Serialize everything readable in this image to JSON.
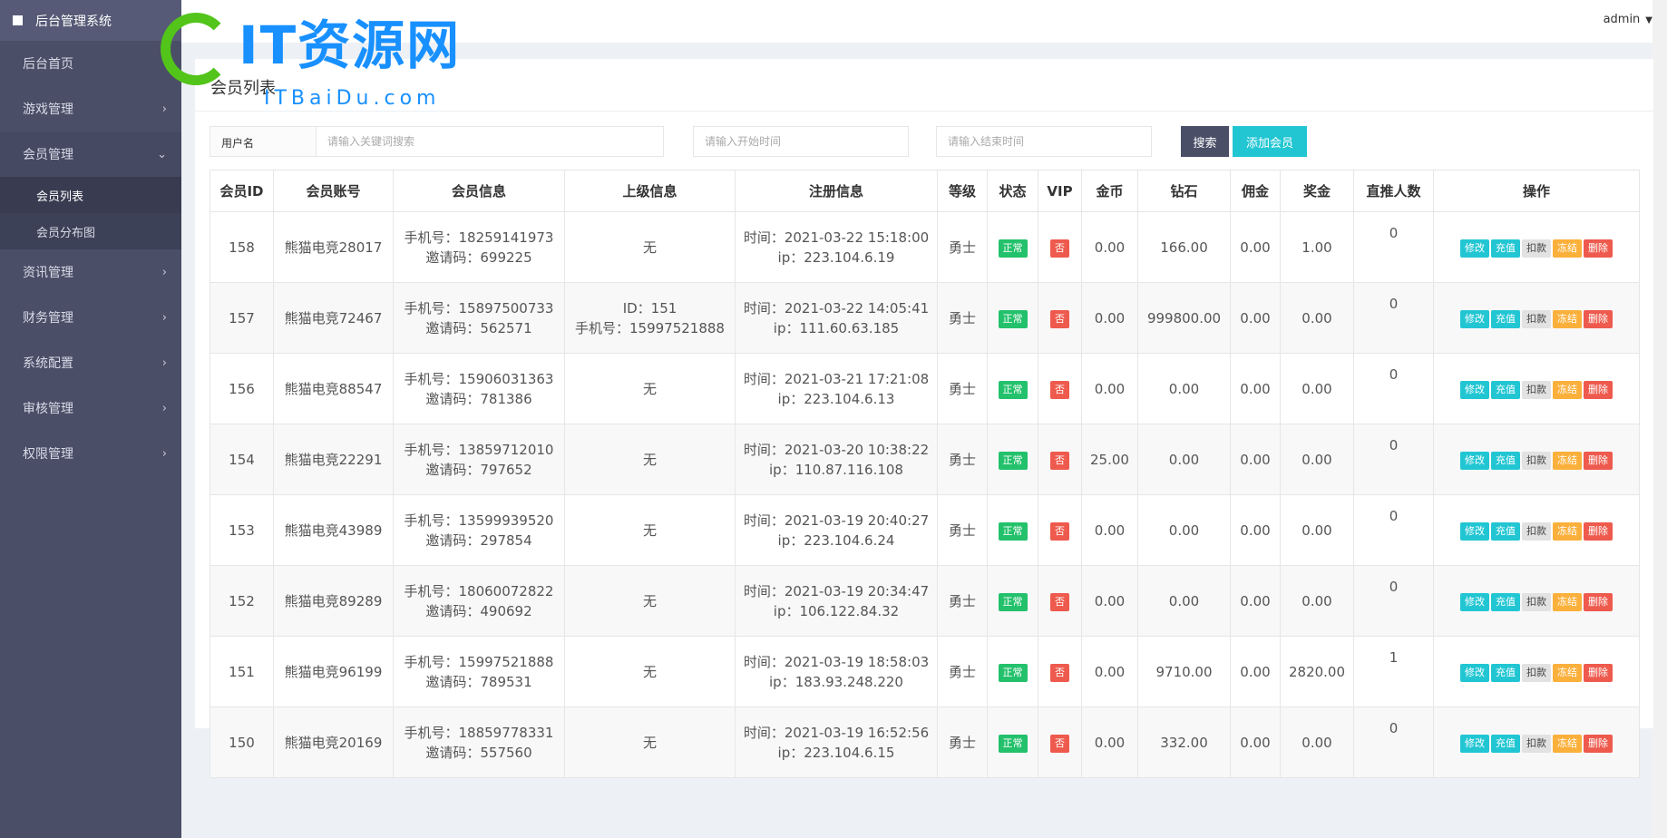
{
  "sidebar": {
    "brand": "后台管理系统",
    "items": [
      {
        "label": "后台首页",
        "has_children": false
      },
      {
        "label": "游戏管理",
        "has_children": true
      },
      {
        "label": "会员管理",
        "has_children": true,
        "open": true,
        "children": [
          {
            "label": "会员列表",
            "active": true
          },
          {
            "label": "会员分布图"
          }
        ]
      },
      {
        "label": "资讯管理",
        "has_children": true
      },
      {
        "label": "财务管理",
        "has_children": true
      },
      {
        "label": "系统配置",
        "has_children": true
      },
      {
        "label": "审核管理",
        "has_children": true
      },
      {
        "label": "权限管理",
        "has_children": true
      }
    ]
  },
  "topbar": {
    "user": "admin"
  },
  "watermark": {
    "big": "IT资源网",
    "small": "ITBaiDu.com"
  },
  "card": {
    "title": "会员列表"
  },
  "search": {
    "label": "用户名",
    "keyword_placeholder": "请输入关键词搜索",
    "start_placeholder": "请输入开始时间",
    "end_placeholder": "请输入结束时间",
    "search_button": "搜索",
    "add_button": "添加会员"
  },
  "colors": {
    "search_btn": "#4a4e67",
    "add_btn": "#22c6d3",
    "sidebar": "#4a4e67"
  },
  "table": {
    "headers": [
      "会员ID",
      "会员账号",
      "会员信息",
      "上级信息",
      "注册信息",
      "等级",
      "状态",
      "VIP",
      "金币",
      "钻石",
      "佣金",
      "奖金",
      "直推人数",
      "操作"
    ],
    "ops": [
      "修改",
      "充值",
      "扣款",
      "冻结",
      "删除"
    ],
    "rows": [
      {
        "id": "158",
        "account": "熊猫电竞28017",
        "phone": "手机号：18259141973",
        "invite": "邀请码：699225",
        "parent1": "无",
        "parent2": "",
        "time": "时间：2021-03-22 15:18:00",
        "ip": "ip：223.104.6.19",
        "level": "勇士",
        "status": "正常",
        "vip": "否",
        "gold": "0.00",
        "diamond": "166.00",
        "commission": "0.00",
        "bonus": "1.00",
        "direct": "0"
      },
      {
        "id": "157",
        "account": "熊猫电竞72467",
        "phone": "手机号：15897500733",
        "invite": "邀请码：562571",
        "parent1": "ID：151",
        "parent2": "手机号：15997521888",
        "time": "时间：2021-03-22 14:05:41",
        "ip": "ip：111.60.63.185",
        "level": "勇士",
        "status": "正常",
        "vip": "否",
        "gold": "0.00",
        "diamond": "999800.00",
        "commission": "0.00",
        "bonus": "0.00",
        "direct": "0"
      },
      {
        "id": "156",
        "account": "熊猫电竞88547",
        "phone": "手机号：15906031363",
        "invite": "邀请码：781386",
        "parent1": "无",
        "parent2": "",
        "time": "时间：2021-03-21 17:21:08",
        "ip": "ip：223.104.6.13",
        "level": "勇士",
        "status": "正常",
        "vip": "否",
        "gold": "0.00",
        "diamond": "0.00",
        "commission": "0.00",
        "bonus": "0.00",
        "direct": "0"
      },
      {
        "id": "154",
        "account": "熊猫电竞22291",
        "phone": "手机号：13859712010",
        "invite": "邀请码：797652",
        "parent1": "无",
        "parent2": "",
        "time": "时间：2021-03-20 10:38:22",
        "ip": "ip：110.87.116.108",
        "level": "勇士",
        "status": "正常",
        "vip": "否",
        "gold": "25.00",
        "diamond": "0.00",
        "commission": "0.00",
        "bonus": "0.00",
        "direct": "0"
      },
      {
        "id": "153",
        "account": "熊猫电竞43989",
        "phone": "手机号：13599939520",
        "invite": "邀请码：297854",
        "parent1": "无",
        "parent2": "",
        "time": "时间：2021-03-19 20:40:27",
        "ip": "ip：223.104.6.24",
        "level": "勇士",
        "status": "正常",
        "vip": "否",
        "gold": "0.00",
        "diamond": "0.00",
        "commission": "0.00",
        "bonus": "0.00",
        "direct": "0"
      },
      {
        "id": "152",
        "account": "熊猫电竞89289",
        "phone": "手机号：18060072822",
        "invite": "邀请码：490692",
        "parent1": "无",
        "parent2": "",
        "time": "时间：2021-03-19 20:34:47",
        "ip": "ip：106.122.84.32",
        "level": "勇士",
        "status": "正常",
        "vip": "否",
        "gold": "0.00",
        "diamond": "0.00",
        "commission": "0.00",
        "bonus": "0.00",
        "direct": "0"
      },
      {
        "id": "151",
        "account": "熊猫电竞96199",
        "phone": "手机号：15997521888",
        "invite": "邀请码：789531",
        "parent1": "无",
        "parent2": "",
        "time": "时间：2021-03-19 18:58:03",
        "ip": "ip：183.93.248.220",
        "level": "勇士",
        "status": "正常",
        "vip": "否",
        "gold": "0.00",
        "diamond": "9710.00",
        "commission": "0.00",
        "bonus": "2820.00",
        "direct": "1"
      },
      {
        "id": "150",
        "account": "熊猫电竞20169",
        "phone": "手机号：18859778331",
        "invite": "邀请码：557560",
        "parent1": "无",
        "parent2": "",
        "time": "时间：2021-03-19 16:52:56",
        "ip": "ip：223.104.6.15",
        "level": "勇士",
        "status": "正常",
        "vip": "否",
        "gold": "0.00",
        "diamond": "332.00",
        "commission": "0.00",
        "bonus": "0.00",
        "direct": "0"
      }
    ]
  }
}
